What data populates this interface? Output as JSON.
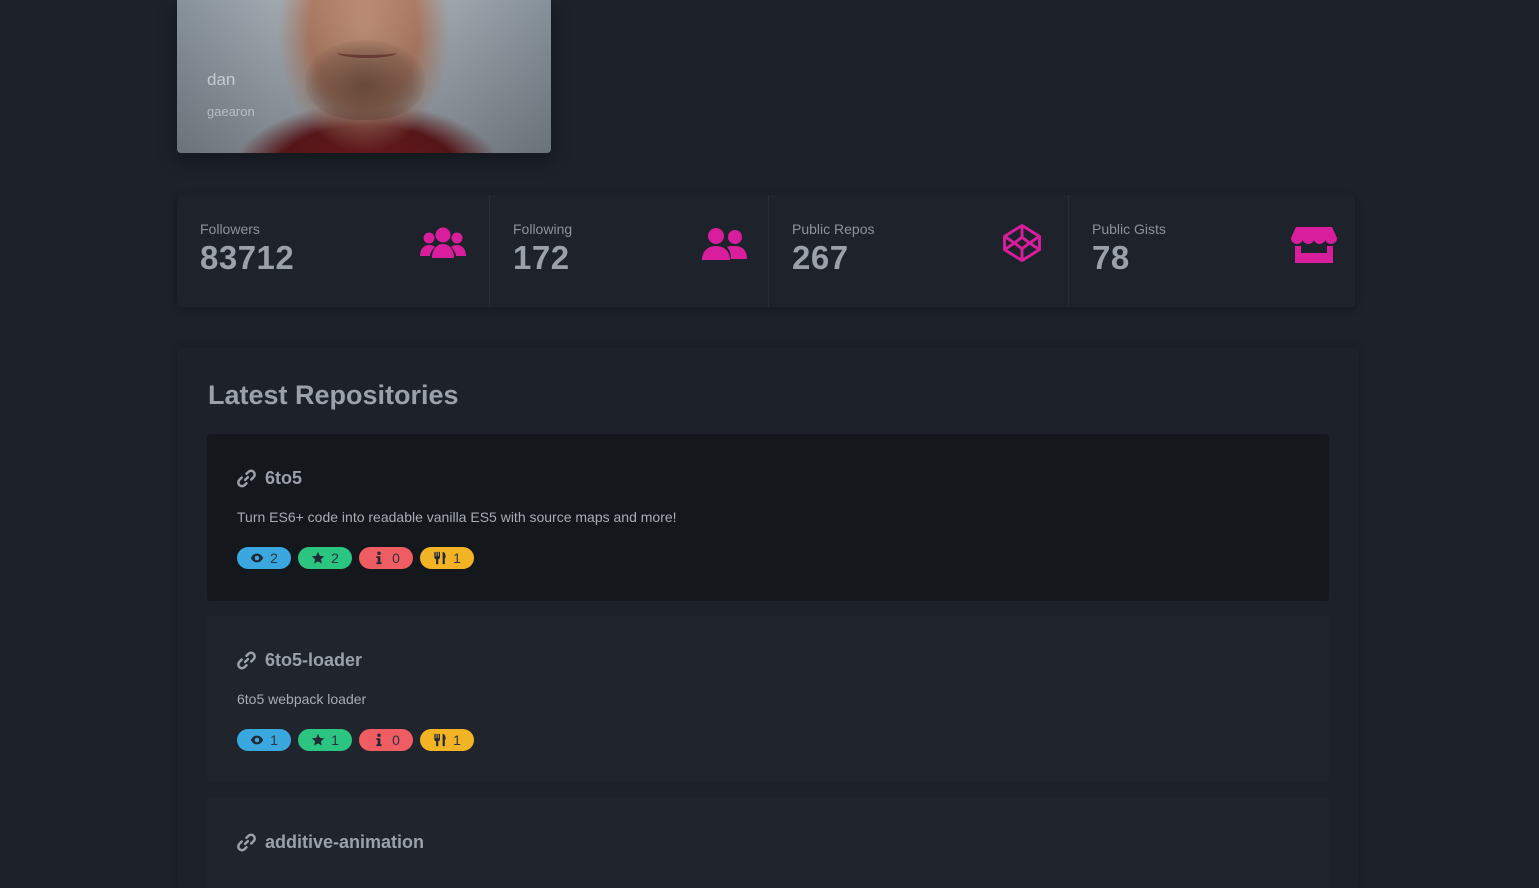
{
  "profile": {
    "name": "dan",
    "login": "gaearon"
  },
  "colors": {
    "accent": "#d81e9c",
    "background": "#1c212a",
    "card_active": "#14171c",
    "watch": "#3aa7df",
    "star": "#2cc481",
    "issue": "#ef5d63",
    "fork": "#f2b324"
  },
  "stats": [
    {
      "label": "Followers",
      "value": "83712",
      "icon": "users-group-icon"
    },
    {
      "label": "Following",
      "value": "172",
      "icon": "user-friends-icon"
    },
    {
      "label": "Public Repos",
      "value": "267",
      "icon": "codepen-icon"
    },
    {
      "label": "Public Gists",
      "value": "78",
      "icon": "store-icon"
    }
  ],
  "repos_section": {
    "title": "Latest Repositories",
    "repos": [
      {
        "name": "6to5",
        "description": "Turn ES6+ code into readable vanilla ES5 with source maps and more!",
        "watchers": "2",
        "stars": "2",
        "issues": "0",
        "forks": "1"
      },
      {
        "name": "6to5-loader",
        "description": "6to5 webpack loader",
        "watchers": "1",
        "stars": "1",
        "issues": "0",
        "forks": "1"
      },
      {
        "name": "additive-animation"
      }
    ]
  }
}
